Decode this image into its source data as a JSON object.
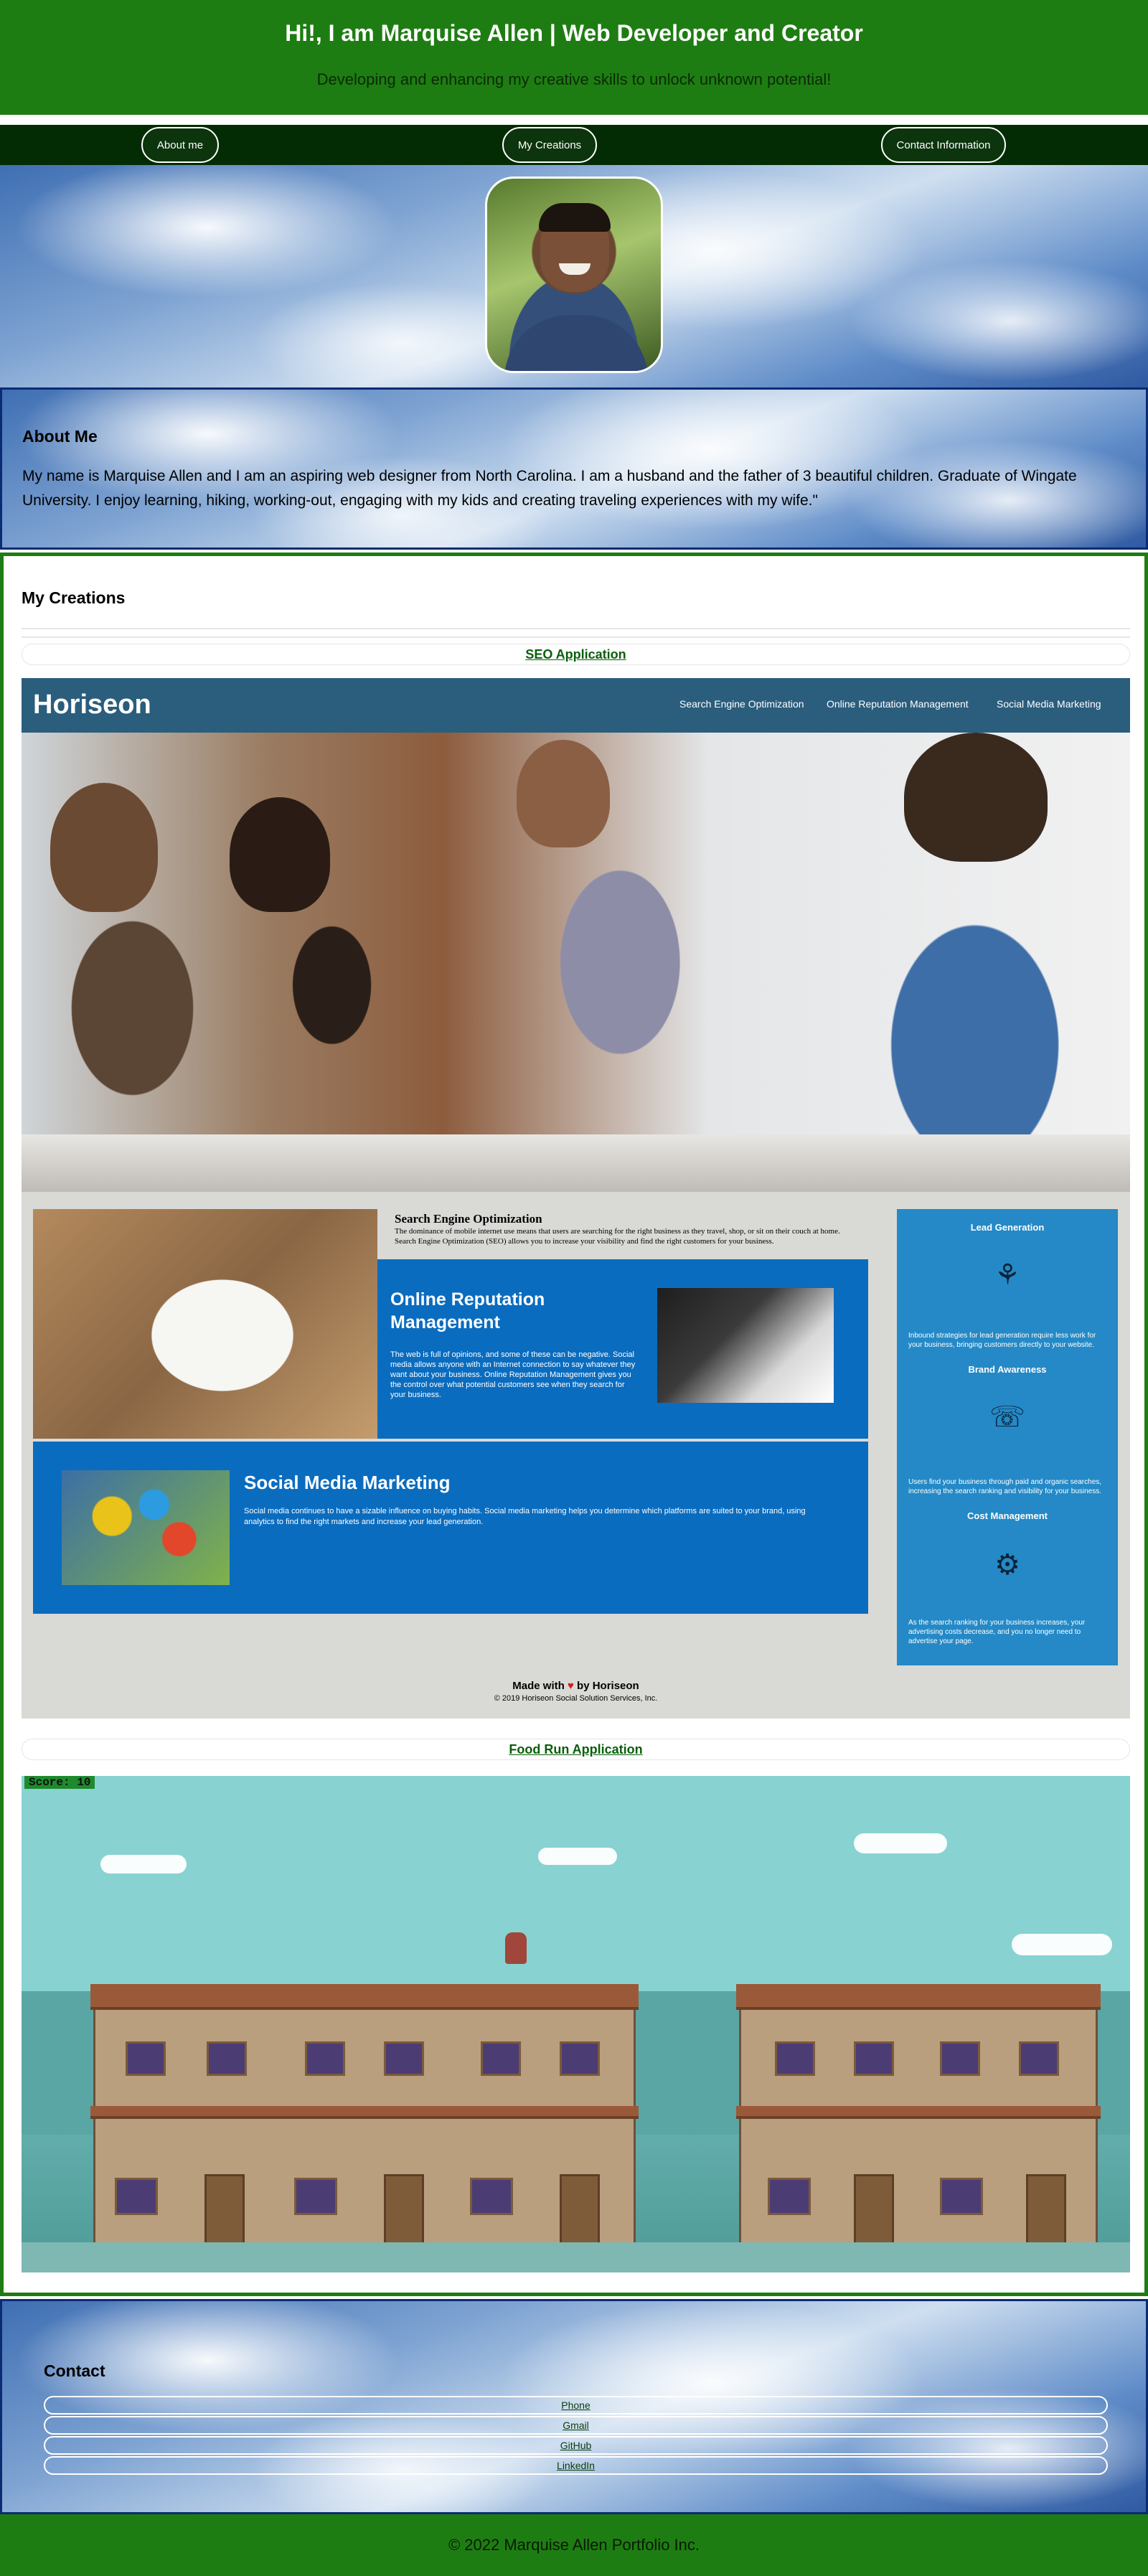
{
  "header": {
    "title": "Hi!, I am Marquise Allen | Web Developer and Creator",
    "tagline": "Developing and enhancing my creative skills to unlock unknown potential!"
  },
  "nav": {
    "items": [
      {
        "label": "About me"
      },
      {
        "label": "My Creations"
      },
      {
        "label": "Contact Information"
      }
    ]
  },
  "about": {
    "heading": "About Me",
    "text": "My name is Marquise Allen and I am an aspiring web designer from North Carolina. I am a husband and the father of 3 beautiful children. Graduate of Wingate University. I enjoy learning, hiking, working-out, engaging with my kids and creating traveling experiences with my wife.\""
  },
  "creations": {
    "heading": "My Creations",
    "apps": [
      {
        "label": "SEO Application"
      },
      {
        "label": "Food Run Application"
      }
    ]
  },
  "horiseon": {
    "logo": "Horiseon",
    "nav": [
      "Search Engine Optimization",
      "Online Reputation Management",
      "Social Media Marketing"
    ],
    "seo": {
      "title": "Search Engine Optimization",
      "text": "The dominance of mobile internet use means that users are searching for the right business as they travel, shop, or sit on their couch at home. Search Engine Optimization (SEO) allows you to increase your visibility and find the right customers for your business."
    },
    "orm": {
      "title": "Online Reputation Management",
      "text": "The web is full of opinions, and some of these can be negative. Social media allows anyone with an Internet connection to say whatever they want about your business. Online Reputation Management gives you the control over what potential customers see when they search for your business."
    },
    "smm": {
      "title": "Social Media Marketing",
      "text": "Social media continues to have a sizable influence on buying habits. Social media marketing helps you determine which platforms are suited to your brand, using analytics to find the right markets and increase your lead generation."
    },
    "aside": [
      {
        "title": "Lead Generation",
        "icon": "lead-generation-icon",
        "text": "Inbound strategies for lead generation require less work for your business, bringing customers directly to your website."
      },
      {
        "title": "Brand Awareness",
        "icon": "brand-awareness-icon",
        "text": "Users find your business through paid and organic searches, increasing the search ranking and visibility for your business."
      },
      {
        "title": "Cost Management",
        "icon": "cost-management-icon",
        "text": "As the search ranking for your business increases, your advertising costs decrease, and you no longer need to advertise your page."
      }
    ],
    "footer": {
      "made_prefix": "Made with",
      "made_suffix": "by Horiseon",
      "copyright": "© 2019 Horiseon Social Solution Services, Inc."
    }
  },
  "foodrun": {
    "score": "Score: 10"
  },
  "contact": {
    "heading": "Contact",
    "items": [
      {
        "label": "Phone"
      },
      {
        "label": "Gmail"
      },
      {
        "label": "GitHub"
      },
      {
        "label": "LinkedIn"
      }
    ]
  },
  "footer": {
    "text": "© 2022 Marquise Allen Portfolio Inc."
  },
  "colors": {
    "header_green": "#1e7d12",
    "nav_dark": "#032c04",
    "border_blue": "#0b2b73",
    "horiseon_blue": "#0a6cbf"
  }
}
